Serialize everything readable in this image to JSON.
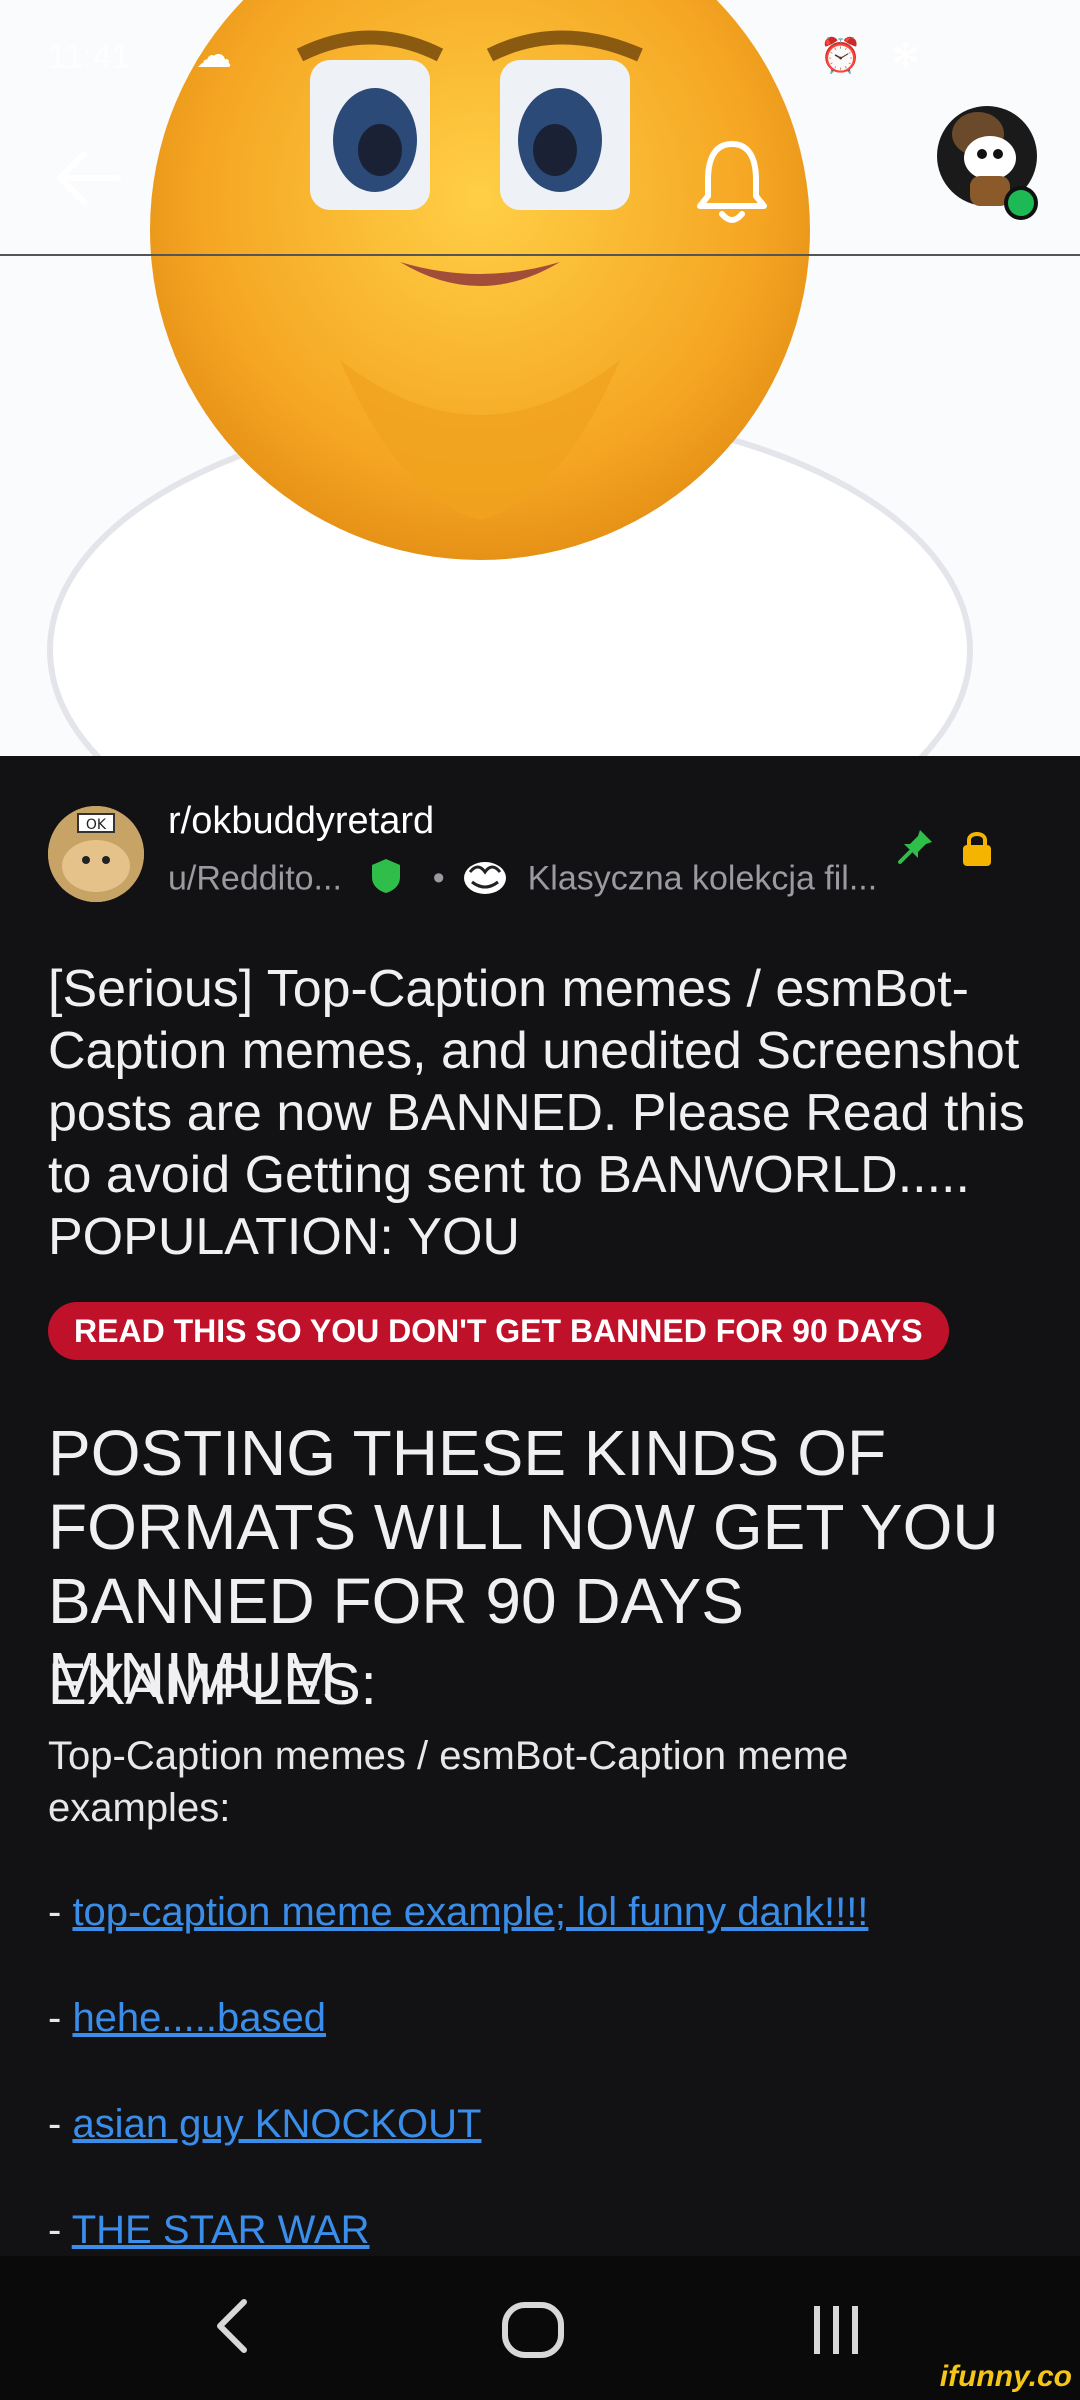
{
  "status_bar": {
    "time": "11:41",
    "right_icons": "⏰ ✻"
  },
  "subreddit": {
    "name": "r/okbuddyretard",
    "avatar_text": "OK"
  },
  "author": {
    "username": "u/Reddito...",
    "separator": "•",
    "flair": "Klasyczna kolekcja fil..."
  },
  "post": {
    "title": "[Serious] Top-Caption memes / esmBot-Caption memes, and unedited Screenshot posts are now BANNED. Please Read this to avoid Getting sent to BANWORLD..... POPULATION: YOU",
    "flair_banner": "READ THIS SO YOU DON'T GET BANNED FOR 90 DAYS",
    "heading": "POSTING THESE KINDS OF FORMATS WILL NOW GET YOU BANNED FOR 90 DAYS MINIMUM.",
    "examples_heading": "EXAMPLES:",
    "body": "Top-Caption memes / esmBot-Caption meme examples:",
    "links": [
      {
        "prefix": "- ",
        "text": "top-caption meme example; lol funny dank!!!!"
      },
      {
        "prefix": "- ",
        "text": "hehe.....based"
      },
      {
        "prefix": "- ",
        "text": "asian guy KNOCKOUT"
      },
      {
        "prefix": "- ",
        "text": "THE STAR WAR"
      }
    ]
  },
  "watermark": "ifunny.co",
  "colors": {
    "background": "#121214",
    "flair_red": "#c0112a",
    "link_blue": "#3a8eea",
    "mod_shield": "#2fbe4a",
    "pin_green": "#2fbe4a",
    "lock_yellow": "#f5b400",
    "online_green": "#1db954"
  },
  "icons": [
    "back-arrow-icon",
    "bell-icon",
    "user-avatar-icon",
    "shield-icon",
    "flair-emoji-icon",
    "pin-icon",
    "lock-icon",
    "nav-back-icon",
    "nav-home-icon",
    "nav-recents-icon"
  ]
}
